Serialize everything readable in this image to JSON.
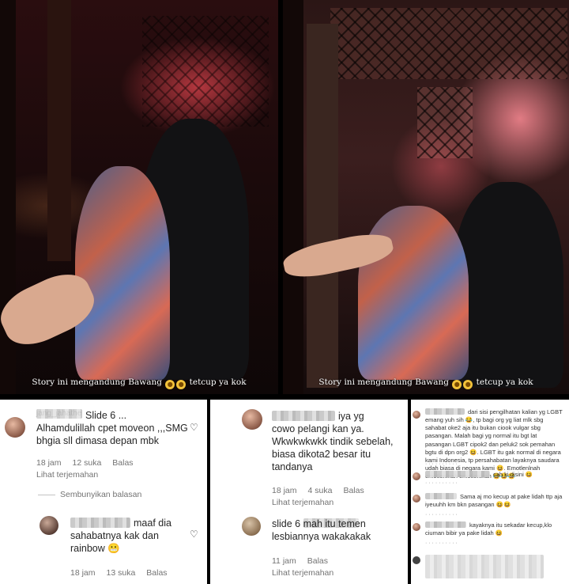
{
  "video": {
    "caption_left": "Story ini mengandung Bawang",
    "caption_right": "Story ini mengandung Bawang",
    "caption_tail": "tetcup ya kok"
  },
  "panel1": {
    "comment1": {
      "username": "jang_jahathe",
      "text": "Slide 6 ...\nAlhamdulillah cpet moveon ,,,SMG\nbhgia sll dimasa depan mbk",
      "time": "18 jam",
      "likes": "12 suka",
      "reply": "Balas",
      "translate": "Lihat terjemahan"
    },
    "hide_replies": "Sembunyikan balasan",
    "reply1": {
      "text": "maaf dia\nsahabatnya kak dan\nrainbow 😬",
      "time": "18 jam",
      "likes": "13 suka",
      "reply": "Balas"
    }
  },
  "panel2": {
    "comment1": {
      "text": "iya yg\ncowo pelangi kan ya.\nWkwkwkwkk tindik sebelah,\nbiasa dikota2 besar itu\ntandanya",
      "time": "18 jam",
      "likes": "4 suka",
      "reply": "Balas",
      "translate": "Lihat terjemahan"
    },
    "comment2": {
      "text": "slide 6 mah itu temen\nlesbiannya wakakakak",
      "time": "11 jam",
      "reply": "Balas",
      "translate": "Lihat terjemahan"
    }
  },
  "panel3": {
    "c1": "dari sisi pengilhatan kalian yg\nLGBT emang yuh sih 😂, tp bagi org yg liat mlk sbg sahabat\noke2 aja itu bukan ciook vulgar sbg pasangan. Malah bagi yg\nnormal itu bgt lat pasangan LGBT cipok2 dan peluk2 sok\npemahan bgtu di dpn org2 😆. LGBT itu gak normal di negara\nkami Indonesia, tp persahabatan layaknya saudara udah biasa\ndi negara kami 😆. Emotlenlnah emotlenlnah emotlenlnah 😂😂😂",
    "c2": "cah ki disini 😆",
    "c3": "Sama aj mo kecup at pake lidah ttp aja iyeuuhh\nkm bkn pasangan 😆😆",
    "c4": "kayaknya itu sekadar kecup,klo\nciuman bibir ya pake lidah 😆"
  }
}
